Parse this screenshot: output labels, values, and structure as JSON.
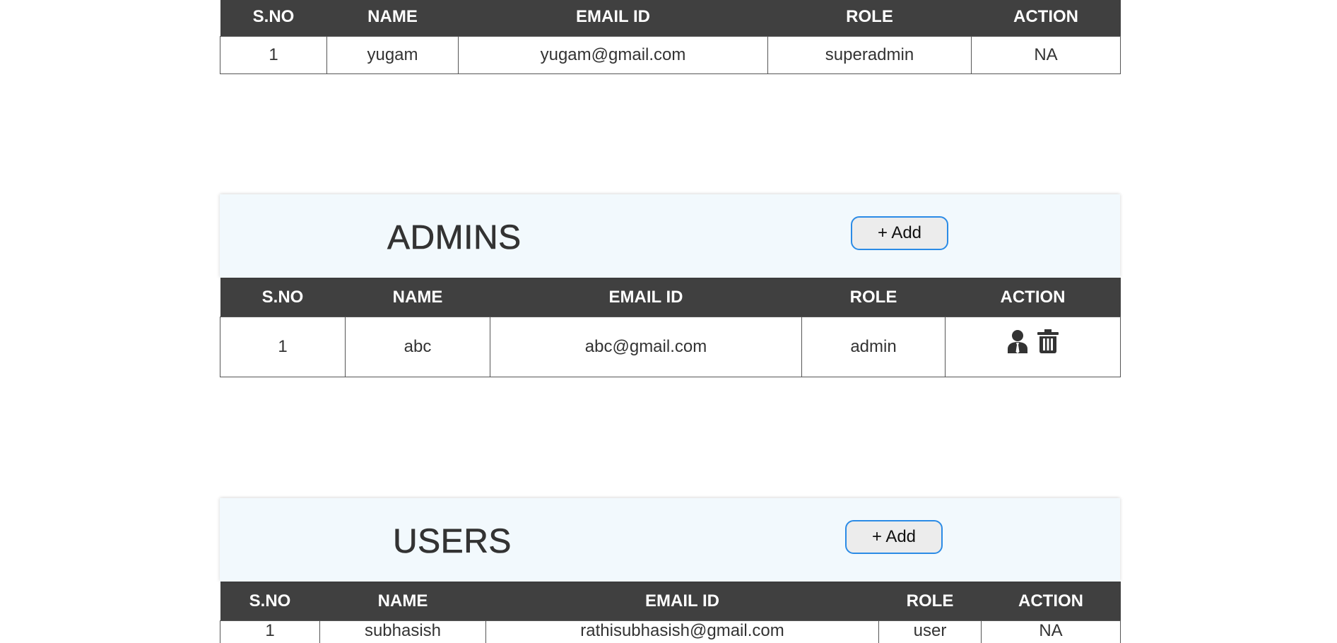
{
  "superadmin_table": {
    "headers": [
      "S.NO",
      "NAME",
      "EMAIL ID",
      "ROLE",
      "ACTION"
    ],
    "rows": [
      {
        "sno": "1",
        "name": "yugam",
        "email": "yugam@gmail.com",
        "role": "superadmin",
        "action": "NA"
      }
    ]
  },
  "admins": {
    "title": "ADMINS",
    "add_label": "+ Add",
    "headers": [
      "S.NO",
      "NAME",
      "EMAIL ID",
      "ROLE",
      "ACTION"
    ],
    "rows": [
      {
        "sno": "1",
        "name": "abc",
        "email": "abc@gmail.com",
        "role": "admin",
        "action_icons": [
          "user-manage-icon",
          "trash-icon"
        ]
      }
    ]
  },
  "users": {
    "title": "USERS",
    "add_label": "+ Add",
    "headers": [
      "S.NO",
      "NAME",
      "EMAIL ID",
      "ROLE",
      "ACTION"
    ],
    "rows": [
      {
        "sno": "1",
        "name": "subhasish",
        "email": "rathisubhasish@gmail.com",
        "role": "user",
        "action": "NA"
      }
    ]
  },
  "colors": {
    "header_bg": "#404040",
    "section_bg": "#f2f9fd",
    "button_border": "#2b8be6"
  }
}
